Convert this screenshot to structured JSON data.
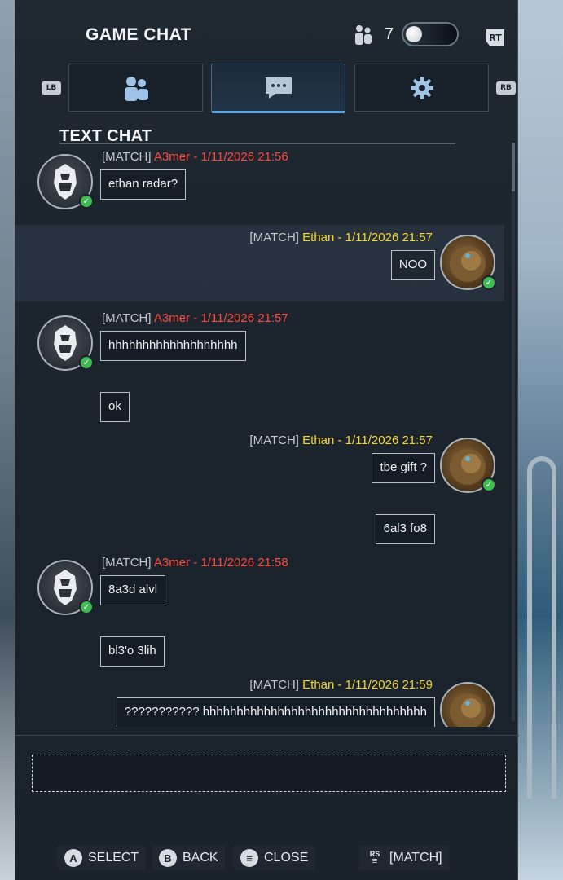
{
  "header": {
    "title": "GAME CHAT",
    "player_count": "7",
    "trigger_label": "RT"
  },
  "tabs": {
    "left_bumper": "LB",
    "right_bumper": "RB",
    "items": [
      {
        "name": "players",
        "icon": "people-icon"
      },
      {
        "name": "chat",
        "icon": "chat-bubble-icon",
        "active": true
      },
      {
        "name": "settings",
        "icon": "gear-icon"
      }
    ]
  },
  "section": {
    "title": "TEXT CHAT"
  },
  "messages": [
    {
      "channel": "[MATCH]",
      "author": "A3mer - 1/11/2026 21:56",
      "side": "left",
      "texts": [
        "ethan radar?"
      ]
    },
    {
      "channel": "[MATCH]",
      "author": "Ethan - 1/11/2026 21:57",
      "side": "right",
      "texts": [
        "NOO"
      ]
    },
    {
      "channel": "[MATCH]",
      "author": "A3mer - 1/11/2026 21:57",
      "side": "left",
      "texts": [
        "hhhhhhhhhhhhhhhhhhh",
        "ok"
      ]
    },
    {
      "channel": "[MATCH]",
      "author": "Ethan - 1/11/2026 21:57",
      "side": "right",
      "texts": [
        "tbe gift ?",
        "6al3 fo8"
      ]
    },
    {
      "channel": "[MATCH]",
      "author": "A3mer - 1/11/2026 21:58",
      "side": "left",
      "texts": [
        "8a3d alvl",
        "bl3'o 3lih"
      ]
    },
    {
      "channel": "[MATCH]",
      "author": "Ethan - 1/11/2026 21:59",
      "side": "right",
      "texts": [
        "??????????? hhhhhhhhhhhhhhhhhhhhhhhhhhhhhhhhh"
      ]
    }
  ],
  "input": {
    "value": ""
  },
  "footer": {
    "select_glyph": "A",
    "select_label": "SELECT",
    "back_glyph": "B",
    "back_label": "BACK",
    "close_glyph": "≡",
    "close_label": "CLOSE",
    "channel_glyph": "RS",
    "channel_label": "[MATCH]"
  },
  "colors": {
    "author_a3mer": "#ff4a3d",
    "author_ethan": "#f4d531",
    "online_status": "#3dbb52",
    "active_tab_accent": "#5aa7e0"
  }
}
